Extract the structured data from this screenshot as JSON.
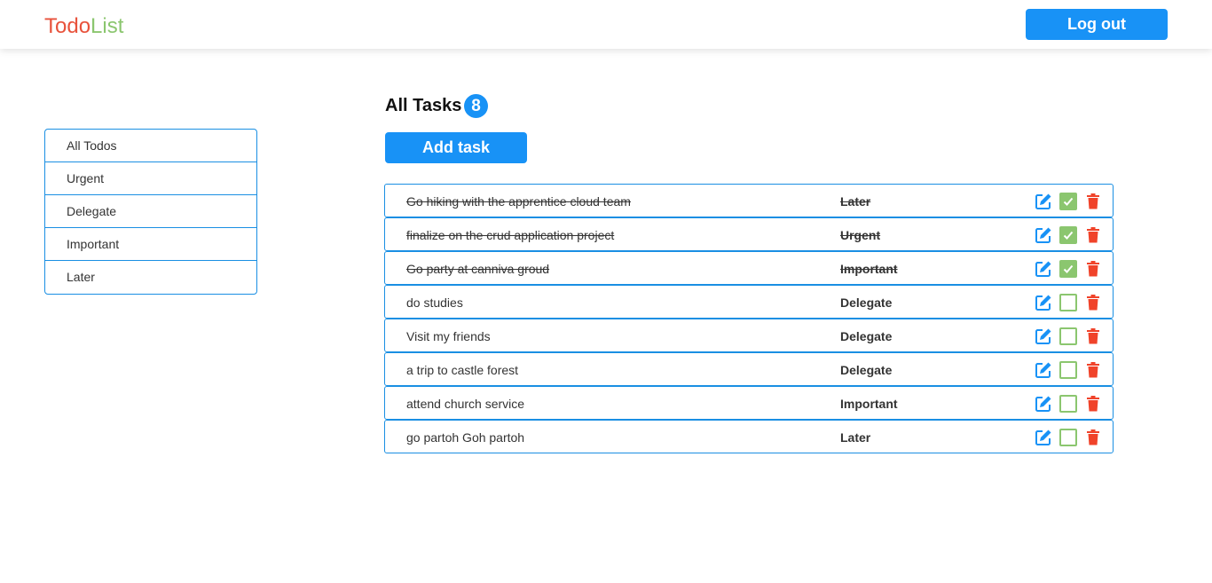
{
  "header": {
    "logo_part1": "Todo",
    "logo_part2": "List",
    "logout_label": "Log out"
  },
  "sidebar": {
    "items": [
      {
        "label": "All Todos"
      },
      {
        "label": "Urgent"
      },
      {
        "label": "Delegate"
      },
      {
        "label": "Important"
      },
      {
        "label": "Later"
      }
    ]
  },
  "main": {
    "title": "All Tasks",
    "count": "8",
    "add_label": "Add task"
  },
  "tasks": [
    {
      "text": "Go hiking with the apprentice cloud team",
      "category": "Later",
      "done": true
    },
    {
      "text": "finalize on the crud application project",
      "category": "Urgent",
      "done": true
    },
    {
      "text": "Go party at canniva groud",
      "category": "Important",
      "done": true
    },
    {
      "text": "do studies",
      "category": "Delegate",
      "done": false
    },
    {
      "text": "Visit my friends",
      "category": "Delegate",
      "done": false
    },
    {
      "text": "a trip to castle forest",
      "category": "Delegate",
      "done": false
    },
    {
      "text": "attend church service",
      "category": "Important",
      "done": false
    },
    {
      "text": "go partoh Goh partoh",
      "category": "Later",
      "done": false
    }
  ],
  "icons": {
    "edit": "edit-icon",
    "checkbox": "checkbox",
    "delete": "trash-icon"
  },
  "colors": {
    "accent": "#1892f6",
    "border": "#1a8fe3",
    "logo_red": "#e8523b",
    "logo_green": "#8bc66f",
    "check_green": "#8bc66f",
    "trash_red": "#f0432a"
  }
}
